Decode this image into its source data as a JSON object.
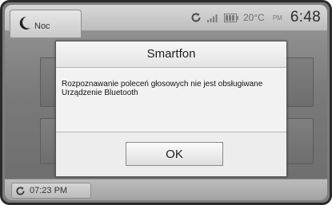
{
  "status_bar": {
    "mode_label": "Noc",
    "temperature": "20°C",
    "ampm": "PM",
    "clock": "6:48"
  },
  "dialog": {
    "title": "Smartfon",
    "message_line1": "Rozpoznawanie poleceń głosowych nie jest obsługiwane",
    "message_line2": "Urządzenie Bluetooth",
    "ok_label": "OK"
  },
  "bottom_bar": {
    "time_label": "07:23 PM"
  },
  "icons": {
    "mode": "moon-icon",
    "connection": "refresh-icon",
    "signal": "signal-bars-icon",
    "battery": "battery-icon",
    "bottom": "refresh-icon"
  }
}
